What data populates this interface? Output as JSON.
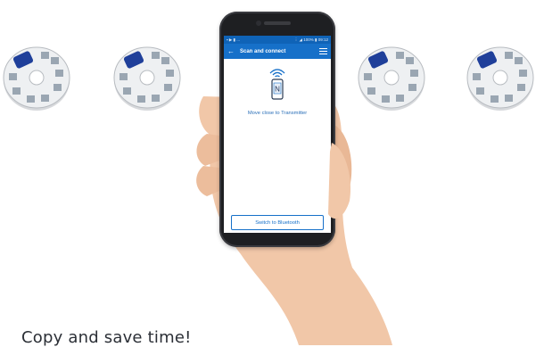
{
  "phone": {
    "status_left": "▪ ▶ ▮ ...",
    "status_right": "⋮ ◢ 100% ▮ 09:12",
    "app_title": "Scan and connect",
    "back_icon": "arrow-left-icon",
    "menu_icon": "hamburger-menu-icon",
    "nfc_letter": "N",
    "hint": "Move close to Transmitter",
    "bluetooth_button": "Switch to Bluetooth"
  },
  "caption": "Copy and save time!",
  "colors": {
    "app_blue": "#1670c9",
    "status_blue": "#0f63b7",
    "transmitter_cap": "#1f3f9a"
  }
}
